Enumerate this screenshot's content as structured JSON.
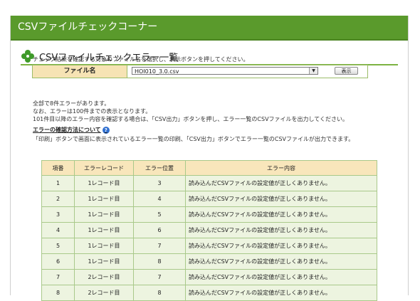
{
  "header": {
    "title": "CSVファイルチェックコーナー"
  },
  "section": {
    "title": "CSVファイルチェックエラー一覧"
  },
  "instruction": "チェック結果を確認する対象のファイル名を選択し、表示ボタンを押してください。",
  "file_select": {
    "label": "ファイル名",
    "selected": "HOI010_3.0.csv",
    "show_button": "表示"
  },
  "messages": [
    "全部で8件エラーがあります。",
    "なお、エラーは100件までの表示となります。",
    "101件目以降のエラー内容を確認する場合は、「CSV出力」ボタンを押し、エラー一覧のCSVファイルを出力してください。"
  ],
  "help": {
    "link": "エラーの確認方法について",
    "icon": "question-icon",
    "description": "「印刷」ボタンで画面に表示されているエラー一覧の印刷、「CSV出力」ボタンでエラー一覧のCSVファイルが出力できます。"
  },
  "table": {
    "headers": [
      "項番",
      "エラーレコード",
      "エラー位置",
      "エラー内容"
    ],
    "rows": [
      [
        "1",
        "1レコード目",
        "3",
        "読み込んだCSVファイルの設定値が正しくありません。"
      ],
      [
        "2",
        "1レコード目",
        "4",
        "読み込んだCSVファイルの設定値が正しくありません。"
      ],
      [
        "3",
        "1レコード目",
        "5",
        "読み込んだCSVファイルの設定値が正しくありません。"
      ],
      [
        "4",
        "1レコード目",
        "6",
        "読み込んだCSVファイルの設定値が正しくありません。"
      ],
      [
        "5",
        "1レコード目",
        "7",
        "読み込んだCSVファイルの設定値が正しくありません。"
      ],
      [
        "6",
        "1レコード目",
        "8",
        "読み込んだCSVファイルの設定値が正しくありません。"
      ],
      [
        "7",
        "2レコード目",
        "7",
        "読み込んだCSVファイルの設定値が正しくありません。"
      ],
      [
        "8",
        "2レコード目",
        "8",
        "読み込んだCSVファイルの設定値が正しくありません。"
      ]
    ]
  },
  "colors": {
    "header_bg": "#5a9a2c",
    "table_header_bg": "#f8e6bb",
    "table_row_bg": "#edf4e0",
    "border": "#a9c98a"
  }
}
